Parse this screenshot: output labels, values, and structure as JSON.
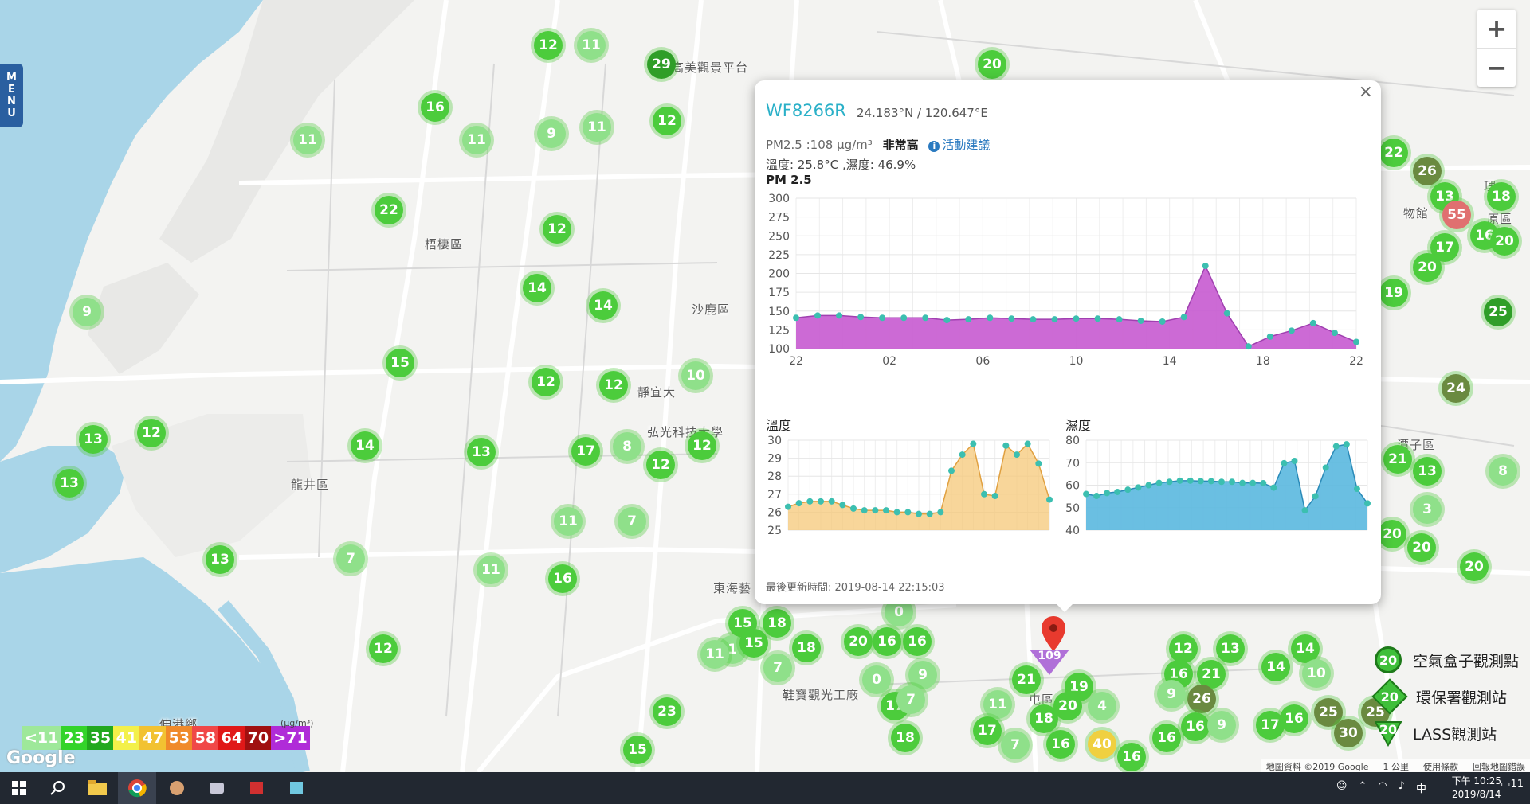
{
  "menu": {
    "label": [
      "M",
      "E",
      "N",
      "U"
    ]
  },
  "zoom": {
    "in": "+",
    "out": "−"
  },
  "places": [
    {
      "name": "梧棲區",
      "x": 533,
      "y": 296
    },
    {
      "name": "沙鹿區",
      "x": 868,
      "y": 378
    },
    {
      "name": "龍井區",
      "x": 365,
      "y": 598
    },
    {
      "name": "東海藝",
      "x": 895,
      "y": 728
    },
    {
      "name": "鞋寶觀光工廠",
      "x": 982,
      "y": 862
    },
    {
      "name": "伸港鄉",
      "x": 200,
      "y": 899
    },
    {
      "name": "高美觀景平台",
      "x": 843,
      "y": 74
    },
    {
      "name": "靜宜大",
      "x": 800,
      "y": 482
    },
    {
      "name": "弘光科技大學",
      "x": 812,
      "y": 532
    },
    {
      "name": "屯區",
      "x": 1291,
      "y": 868
    },
    {
      "name": "潭子區",
      "x": 1753,
      "y": 548
    },
    {
      "name": "物館",
      "x": 1761,
      "y": 257
    },
    {
      "name": "原區",
      "x": 1866,
      "y": 264
    },
    {
      "name": "理",
      "x": 1862,
      "y": 223
    }
  ],
  "markers": [
    {
      "v": "12",
      "x": 688,
      "y": 57
    },
    {
      "v": "11",
      "x": 742,
      "y": 57
    },
    {
      "v": "29",
      "x": 830,
      "y": 81
    },
    {
      "v": "20",
      "x": 1245,
      "y": 81
    },
    {
      "v": "16",
      "x": 546,
      "y": 135
    },
    {
      "v": "11",
      "x": 386,
      "y": 176
    },
    {
      "v": "11",
      "x": 598,
      "y": 176
    },
    {
      "v": "9",
      "x": 692,
      "y": 168
    },
    {
      "v": "11",
      "x": 749,
      "y": 160
    },
    {
      "v": "12",
      "x": 837,
      "y": 152
    },
    {
      "v": "22",
      "x": 488,
      "y": 264
    },
    {
      "v": "12",
      "x": 699,
      "y": 288
    },
    {
      "v": "14",
      "x": 674,
      "y": 362
    },
    {
      "v": "14",
      "x": 757,
      "y": 384
    },
    {
      "v": "9",
      "x": 109,
      "y": 392
    },
    {
      "v": "15",
      "x": 502,
      "y": 456
    },
    {
      "v": "12",
      "x": 685,
      "y": 480
    },
    {
      "v": "12",
      "x": 770,
      "y": 484
    },
    {
      "v": "10",
      "x": 873,
      "y": 472
    },
    {
      "v": "13",
      "x": 117,
      "y": 552
    },
    {
      "v": "12",
      "x": 190,
      "y": 544
    },
    {
      "v": "14",
      "x": 458,
      "y": 560
    },
    {
      "v": "13",
      "x": 604,
      "y": 568
    },
    {
      "v": "17",
      "x": 735,
      "y": 567
    },
    {
      "v": "8",
      "x": 787,
      "y": 561
    },
    {
      "v": "12",
      "x": 829,
      "y": 584
    },
    {
      "v": "12",
      "x": 881,
      "y": 560
    },
    {
      "v": "13",
      "x": 87,
      "y": 607
    },
    {
      "v": "11",
      "x": 713,
      "y": 655
    },
    {
      "v": "7",
      "x": 793,
      "y": 655
    },
    {
      "v": "13",
      "x": 276,
      "y": 703
    },
    {
      "v": "7",
      "x": 440,
      "y": 702
    },
    {
      "v": "11",
      "x": 616,
      "y": 716
    },
    {
      "v": "16",
      "x": 706,
      "y": 727
    },
    {
      "v": "12",
      "x": 481,
      "y": 815
    },
    {
      "v": "15",
      "x": 932,
      "y": 783
    },
    {
      "v": "18",
      "x": 975,
      "y": 783
    },
    {
      "v": "1",
      "x": 919,
      "y": 816
    },
    {
      "v": "15",
      "x": 946,
      "y": 808
    },
    {
      "v": "11",
      "x": 897,
      "y": 822
    },
    {
      "v": "18",
      "x": 1012,
      "y": 814
    },
    {
      "v": "7",
      "x": 976,
      "y": 839
    },
    {
      "v": "0",
      "x": 1128,
      "y": 769
    },
    {
      "v": "20",
      "x": 1077,
      "y": 806
    },
    {
      "v": "16",
      "x": 1113,
      "y": 806
    },
    {
      "v": "16",
      "x": 1151,
      "y": 806
    },
    {
      "v": "0",
      "x": 1100,
      "y": 854
    },
    {
      "v": "9",
      "x": 1158,
      "y": 848
    },
    {
      "v": "17",
      "x": 1123,
      "y": 887
    },
    {
      "v": "7",
      "x": 1143,
      "y": 879
    },
    {
      "v": "23",
      "x": 837,
      "y": 894
    },
    {
      "v": "18",
      "x": 1136,
      "y": 927
    },
    {
      "v": "15",
      "x": 800,
      "y": 942
    },
    {
      "v": "21",
      "x": 1288,
      "y": 854
    },
    {
      "v": "11",
      "x": 1252,
      "y": 885
    },
    {
      "v": "19",
      "x": 1354,
      "y": 863
    },
    {
      "v": "20",
      "x": 1340,
      "y": 887
    },
    {
      "v": "4",
      "x": 1383,
      "y": 887
    },
    {
      "v": "18",
      "x": 1310,
      "y": 903
    },
    {
      "v": "17",
      "x": 1239,
      "y": 918
    },
    {
      "v": "7",
      "x": 1274,
      "y": 936
    },
    {
      "v": "16",
      "x": 1331,
      "y": 935
    },
    {
      "v": "40",
      "x": 1383,
      "y": 935,
      "c": "#f0d040"
    },
    {
      "v": "16",
      "x": 1420,
      "y": 951
    },
    {
      "v": "12",
      "x": 1485,
      "y": 815
    },
    {
      "v": "13",
      "x": 1544,
      "y": 815
    },
    {
      "v": "16",
      "x": 1479,
      "y": 847
    },
    {
      "v": "21",
      "x": 1520,
      "y": 847
    },
    {
      "v": "26",
      "x": 1508,
      "y": 878,
      "c": "#6a8a40"
    },
    {
      "v": "9",
      "x": 1470,
      "y": 872
    },
    {
      "v": "16",
      "x": 1500,
      "y": 913
    },
    {
      "v": "9",
      "x": 1533,
      "y": 911
    },
    {
      "v": "16",
      "x": 1464,
      "y": 927
    },
    {
      "v": "17",
      "x": 1594,
      "y": 911
    },
    {
      "v": "16",
      "x": 1624,
      "y": 903
    },
    {
      "v": "14",
      "x": 1638,
      "y": 815
    },
    {
      "v": "14",
      "x": 1601,
      "y": 838
    },
    {
      "v": "10",
      "x": 1652,
      "y": 846
    },
    {
      "v": "25",
      "x": 1667,
      "y": 895,
      "c": "#6a8a40"
    },
    {
      "v": "25",
      "x": 1726,
      "y": 895,
      "c": "#6a8a40"
    },
    {
      "v": "30",
      "x": 1692,
      "y": 921,
      "c": "#6a8a40"
    },
    {
      "v": "22",
      "x": 1749,
      "y": 192
    },
    {
      "v": "26",
      "x": 1791,
      "y": 215,
      "c": "#6a8a40"
    },
    {
      "v": "13",
      "x": 1813,
      "y": 247
    },
    {
      "v": "55",
      "x": 1828,
      "y": 270,
      "c": "#e07070"
    },
    {
      "v": "18",
      "x": 1884,
      "y": 247
    },
    {
      "v": "16",
      "x": 1863,
      "y": 296
    },
    {
      "v": "17",
      "x": 1813,
      "y": 311
    },
    {
      "v": "20",
      "x": 1791,
      "y": 336
    },
    {
      "v": "20",
      "x": 1888,
      "y": 303
    },
    {
      "v": "19",
      "x": 1749,
      "y": 368
    },
    {
      "v": "25",
      "x": 1880,
      "y": 392
    },
    {
      "v": "24",
      "x": 1827,
      "y": 488,
      "c": "#6a8a40"
    },
    {
      "v": "21",
      "x": 1754,
      "y": 577
    },
    {
      "v": "13",
      "x": 1791,
      "y": 592
    },
    {
      "v": "8",
      "x": 1886,
      "y": 592
    },
    {
      "v": "3",
      "x": 1791,
      "y": 640
    },
    {
      "v": "20",
      "x": 1747,
      "y": 671
    },
    {
      "v": "20",
      "x": 1784,
      "y": 688
    },
    {
      "v": "20",
      "x": 1850,
      "y": 712
    }
  ],
  "popup": {
    "close": "×",
    "station_id": "WF8266R",
    "coords": "24.183°N / 120.647°E",
    "pm_reading": "PM2.5 :108 μg/m³",
    "level": "非常高",
    "advice_icon": "i",
    "advice": "活動建議",
    "temp_humidity": "溫度: 25.8°C ,濕度: 46.9%",
    "pm_title": "PM 2.5",
    "temp_title": "溫度",
    "hum_title": "濕度",
    "updated": "最後更新時間: 2019-08-14 22:15:03"
  },
  "chart_data": [
    {
      "type": "area",
      "title": "PM 2.5",
      "x_tick_labels": [
        "22",
        "02",
        "06",
        "10",
        "14",
        "18",
        "22"
      ],
      "ylim": [
        100,
        300
      ],
      "y_ticks": [
        100,
        125,
        150,
        175,
        200,
        225,
        250,
        275,
        300
      ],
      "color": "#c65ad0",
      "values": [
        141,
        144,
        144,
        142,
        141,
        141,
        141,
        138,
        139,
        141,
        140,
        139,
        139,
        140,
        140,
        139,
        137,
        136,
        142,
        210,
        147,
        103,
        116,
        124,
        134,
        121,
        109
      ]
    },
    {
      "type": "area",
      "title": "溫度",
      "ylim": [
        25,
        30
      ],
      "y_ticks": [
        25,
        26,
        27,
        28,
        29,
        30
      ],
      "color": "#f5c878",
      "values": [
        26.3,
        26.5,
        26.6,
        26.6,
        26.6,
        26.4,
        26.2,
        26.1,
        26.1,
        26.1,
        26.0,
        26.0,
        25.9,
        25.9,
        26.0,
        28.3,
        29.2,
        29.8,
        27.0,
        26.9,
        29.7,
        29.2,
        29.8,
        28.7,
        26.7
      ]
    },
    {
      "type": "area",
      "title": "濕度",
      "ylim": [
        40,
        80
      ],
      "y_ticks": [
        40,
        50,
        60,
        70,
        80
      ],
      "color": "#5ab8df",
      "values": [
        56.1,
        55.2,
        56.5,
        57.0,
        58.0,
        59.0,
        60.0,
        61.0,
        61.5,
        62.0,
        62.0,
        61.8,
        61.8,
        61.5,
        61.5,
        61.0,
        61.0,
        60.9,
        58.9,
        69.8,
        70.8,
        48.8,
        55.1,
        67.8,
        77.3,
        78.2,
        58.4,
        51.9
      ]
    }
  ],
  "pin": {
    "value": "109"
  },
  "scale": {
    "unit": "(μg/m³)",
    "items": [
      {
        "label": "<11",
        "color": "#9ee89a"
      },
      {
        "label": "23",
        "color": "#33d42a"
      },
      {
        "label": "35",
        "color": "#22a81e"
      },
      {
        "label": "41",
        "color": "#f3f04a"
      },
      {
        "label": "47",
        "color": "#f2c232"
      },
      {
        "label": "53",
        "color": "#f08a2a"
      },
      {
        "label": "58",
        "color": "#f04848"
      },
      {
        "label": "64",
        "color": "#e01818"
      },
      {
        "label": "70",
        "color": "#a01010"
      },
      {
        "label": ">71",
        "color": "#b02cd8"
      }
    ]
  },
  "legend": [
    {
      "label": "空氣盒子觀測點",
      "value": "20",
      "shape": "circle"
    },
    {
      "label": "環保署觀測站",
      "value": "20",
      "shape": "diamond"
    },
    {
      "label": "LASS觀測站",
      "value": "20",
      "shape": "triangle"
    }
  ],
  "google_logo": "Google",
  "attribution": {
    "map_data": "地圖資料 ©2019 Google",
    "scale": "1 公里",
    "terms": "使用條款",
    "report": "回報地圖錯誤"
  },
  "taskbar": {
    "apps": [
      "start-icon",
      "search-icon",
      "file-explorer-icon",
      "chrome-icon",
      "app-icon-1",
      "app-icon-2",
      "app-icon-3",
      "app-icon-4"
    ],
    "ime": "中",
    "time": "下午 10:25",
    "date": "2019/8/14",
    "notifications": "11"
  }
}
